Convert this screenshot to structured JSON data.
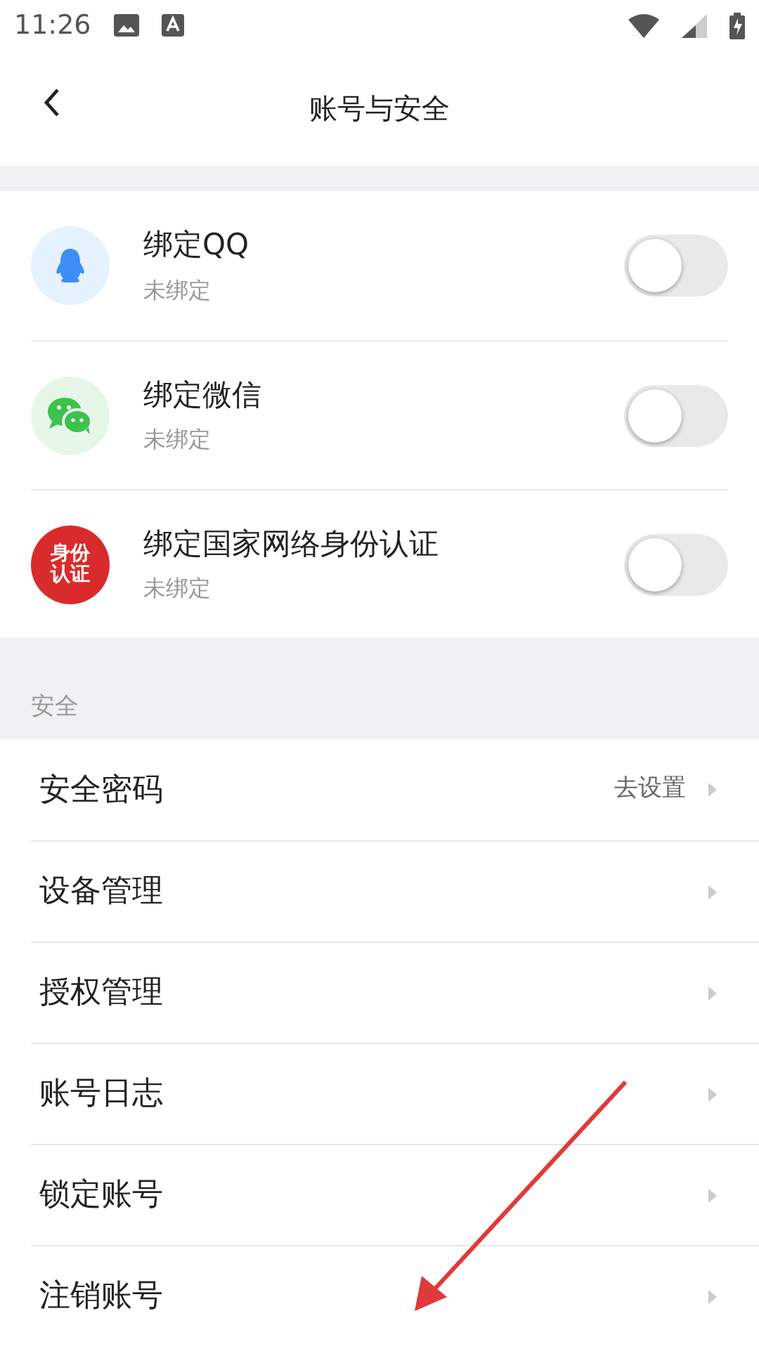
{
  "status_bar": {
    "time": "11:26"
  },
  "header": {
    "title": "账号与安全"
  },
  "bindings": [
    {
      "kind": "qq",
      "title": "绑定QQ",
      "subtitle": "未绑定",
      "on": false
    },
    {
      "kind": "wechat",
      "title": "绑定微信",
      "subtitle": "未绑定",
      "on": false
    },
    {
      "kind": "idcard",
      "badge_text": "身份认证",
      "title": "绑定国家网络身份认证",
      "subtitle": "未绑定",
      "on": false
    }
  ],
  "security": {
    "heading": "安全",
    "items": [
      {
        "label": "安全密码",
        "value": "去设置"
      },
      {
        "label": "设备管理"
      },
      {
        "label": "授权管理"
      },
      {
        "label": "账号日志"
      },
      {
        "label": "锁定账号"
      },
      {
        "label": "注销账号"
      }
    ]
  },
  "annotation": {
    "kind": "arrow"
  }
}
